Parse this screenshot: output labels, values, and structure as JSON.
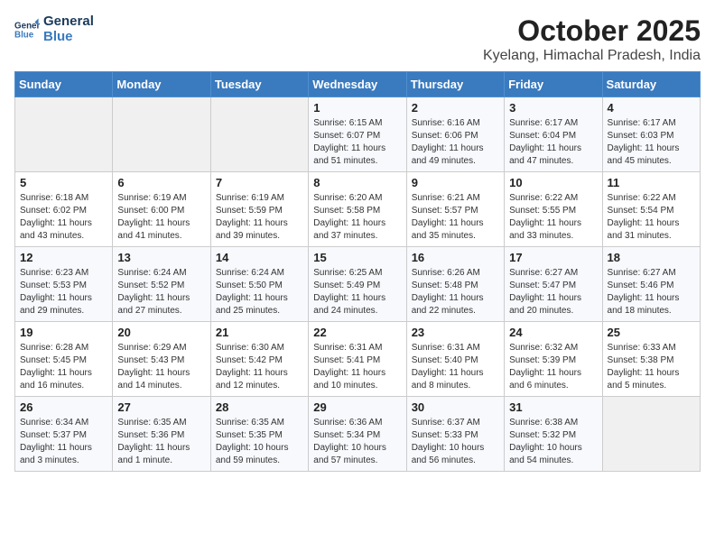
{
  "logo": {
    "line1": "General",
    "line2": "Blue"
  },
  "title": "October 2025",
  "location": "Kyelang, Himachal Pradesh, India",
  "days_of_week": [
    "Sunday",
    "Monday",
    "Tuesday",
    "Wednesday",
    "Thursday",
    "Friday",
    "Saturday"
  ],
  "weeks": [
    [
      {
        "day": "",
        "info": ""
      },
      {
        "day": "",
        "info": ""
      },
      {
        "day": "",
        "info": ""
      },
      {
        "day": "1",
        "info": "Sunrise: 6:15 AM\nSunset: 6:07 PM\nDaylight: 11 hours\nand 51 minutes."
      },
      {
        "day": "2",
        "info": "Sunrise: 6:16 AM\nSunset: 6:06 PM\nDaylight: 11 hours\nand 49 minutes."
      },
      {
        "day": "3",
        "info": "Sunrise: 6:17 AM\nSunset: 6:04 PM\nDaylight: 11 hours\nand 47 minutes."
      },
      {
        "day": "4",
        "info": "Sunrise: 6:17 AM\nSunset: 6:03 PM\nDaylight: 11 hours\nand 45 minutes."
      }
    ],
    [
      {
        "day": "5",
        "info": "Sunrise: 6:18 AM\nSunset: 6:02 PM\nDaylight: 11 hours\nand 43 minutes."
      },
      {
        "day": "6",
        "info": "Sunrise: 6:19 AM\nSunset: 6:00 PM\nDaylight: 11 hours\nand 41 minutes."
      },
      {
        "day": "7",
        "info": "Sunrise: 6:19 AM\nSunset: 5:59 PM\nDaylight: 11 hours\nand 39 minutes."
      },
      {
        "day": "8",
        "info": "Sunrise: 6:20 AM\nSunset: 5:58 PM\nDaylight: 11 hours\nand 37 minutes."
      },
      {
        "day": "9",
        "info": "Sunrise: 6:21 AM\nSunset: 5:57 PM\nDaylight: 11 hours\nand 35 minutes."
      },
      {
        "day": "10",
        "info": "Sunrise: 6:22 AM\nSunset: 5:55 PM\nDaylight: 11 hours\nand 33 minutes."
      },
      {
        "day": "11",
        "info": "Sunrise: 6:22 AM\nSunset: 5:54 PM\nDaylight: 11 hours\nand 31 minutes."
      }
    ],
    [
      {
        "day": "12",
        "info": "Sunrise: 6:23 AM\nSunset: 5:53 PM\nDaylight: 11 hours\nand 29 minutes."
      },
      {
        "day": "13",
        "info": "Sunrise: 6:24 AM\nSunset: 5:52 PM\nDaylight: 11 hours\nand 27 minutes."
      },
      {
        "day": "14",
        "info": "Sunrise: 6:24 AM\nSunset: 5:50 PM\nDaylight: 11 hours\nand 25 minutes."
      },
      {
        "day": "15",
        "info": "Sunrise: 6:25 AM\nSunset: 5:49 PM\nDaylight: 11 hours\nand 24 minutes."
      },
      {
        "day": "16",
        "info": "Sunrise: 6:26 AM\nSunset: 5:48 PM\nDaylight: 11 hours\nand 22 minutes."
      },
      {
        "day": "17",
        "info": "Sunrise: 6:27 AM\nSunset: 5:47 PM\nDaylight: 11 hours\nand 20 minutes."
      },
      {
        "day": "18",
        "info": "Sunrise: 6:27 AM\nSunset: 5:46 PM\nDaylight: 11 hours\nand 18 minutes."
      }
    ],
    [
      {
        "day": "19",
        "info": "Sunrise: 6:28 AM\nSunset: 5:45 PM\nDaylight: 11 hours\nand 16 minutes."
      },
      {
        "day": "20",
        "info": "Sunrise: 6:29 AM\nSunset: 5:43 PM\nDaylight: 11 hours\nand 14 minutes."
      },
      {
        "day": "21",
        "info": "Sunrise: 6:30 AM\nSunset: 5:42 PM\nDaylight: 11 hours\nand 12 minutes."
      },
      {
        "day": "22",
        "info": "Sunrise: 6:31 AM\nSunset: 5:41 PM\nDaylight: 11 hours\nand 10 minutes."
      },
      {
        "day": "23",
        "info": "Sunrise: 6:31 AM\nSunset: 5:40 PM\nDaylight: 11 hours\nand 8 minutes."
      },
      {
        "day": "24",
        "info": "Sunrise: 6:32 AM\nSunset: 5:39 PM\nDaylight: 11 hours\nand 6 minutes."
      },
      {
        "day": "25",
        "info": "Sunrise: 6:33 AM\nSunset: 5:38 PM\nDaylight: 11 hours\nand 5 minutes."
      }
    ],
    [
      {
        "day": "26",
        "info": "Sunrise: 6:34 AM\nSunset: 5:37 PM\nDaylight: 11 hours\nand 3 minutes."
      },
      {
        "day": "27",
        "info": "Sunrise: 6:35 AM\nSunset: 5:36 PM\nDaylight: 11 hours\nand 1 minute."
      },
      {
        "day": "28",
        "info": "Sunrise: 6:35 AM\nSunset: 5:35 PM\nDaylight: 10 hours\nand 59 minutes."
      },
      {
        "day": "29",
        "info": "Sunrise: 6:36 AM\nSunset: 5:34 PM\nDaylight: 10 hours\nand 57 minutes."
      },
      {
        "day": "30",
        "info": "Sunrise: 6:37 AM\nSunset: 5:33 PM\nDaylight: 10 hours\nand 56 minutes."
      },
      {
        "day": "31",
        "info": "Sunrise: 6:38 AM\nSunset: 5:32 PM\nDaylight: 10 hours\nand 54 minutes."
      },
      {
        "day": "",
        "info": ""
      }
    ]
  ]
}
